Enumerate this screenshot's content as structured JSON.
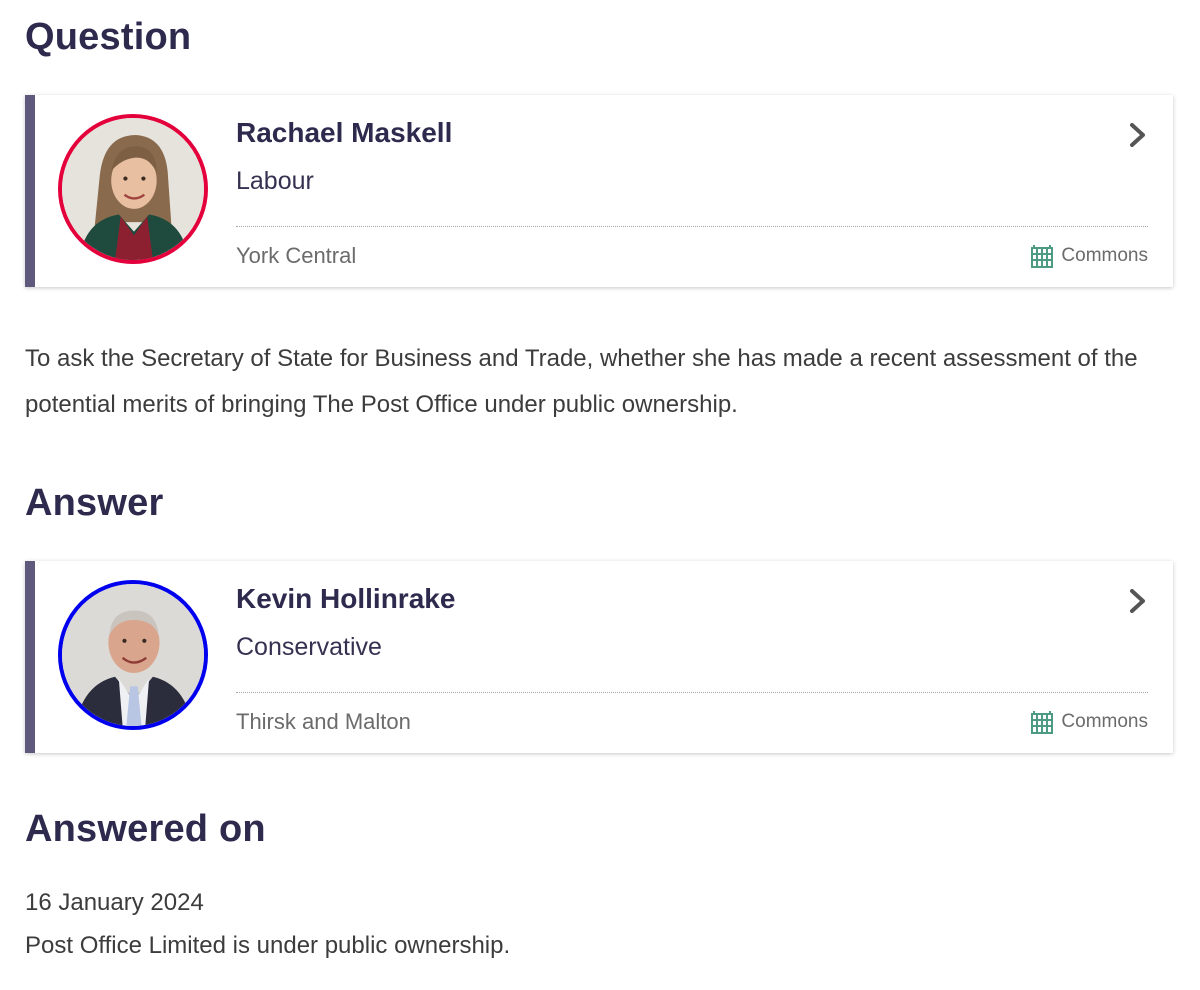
{
  "question": {
    "heading": "Question",
    "member": {
      "name": "Rachael Maskell",
      "party": "Labour",
      "constituency": "York Central",
      "house": "Commons",
      "party_color": "#e4003b",
      "house_icon": "portcullis-icon"
    },
    "text": "To ask the Secretary of State for Business and Trade, whether she has made a recent assessment of the potential merits of bringing The Post Office under public ownership."
  },
  "answer": {
    "heading": "Answer",
    "member": {
      "name": "Kevin Hollinrake",
      "party": "Conservative",
      "constituency": "Thirsk and Malton",
      "house": "Commons",
      "party_color": "#0000ee",
      "house_icon": "portcullis-icon"
    }
  },
  "answered_on": {
    "heading": "Answered on",
    "date": "16 January 2024",
    "text": "Post Office Limited is under public ownership."
  },
  "colors": {
    "heading": "#2e2a4d",
    "card_accent": "#5f5a7d",
    "commons_green": "#4d9b82"
  }
}
